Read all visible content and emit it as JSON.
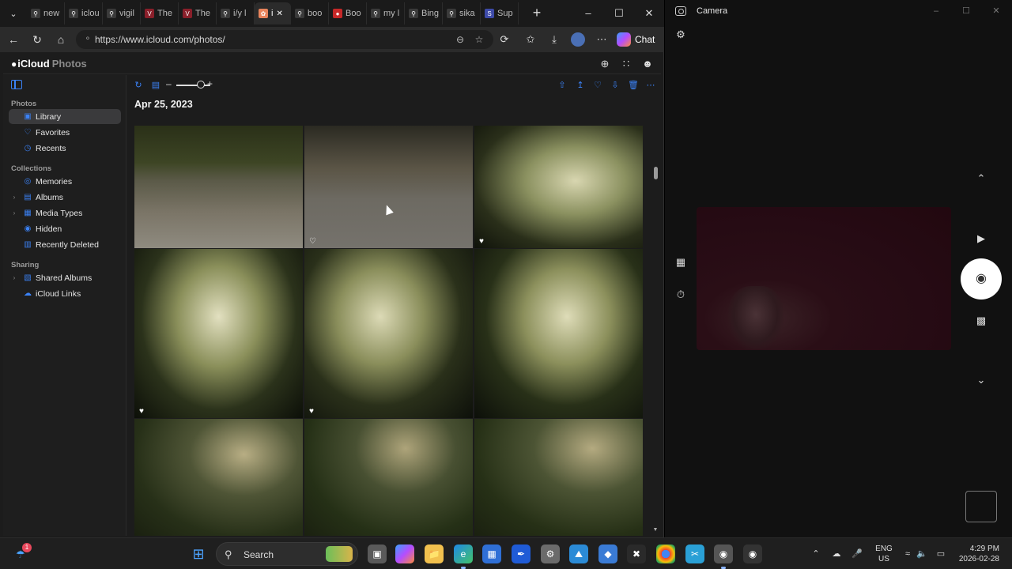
{
  "browser": {
    "tabs": [
      {
        "title": "new",
        "icon": "search-icon",
        "color": "#3a3a3a"
      },
      {
        "title": "iclou",
        "icon": "search-icon",
        "color": "#3a3a3a"
      },
      {
        "title": "vigil",
        "icon": "search-icon",
        "color": "#3a3a3a"
      },
      {
        "title": "The",
        "icon": "vi-icon",
        "color": "#8a1f2a"
      },
      {
        "title": "The",
        "icon": "vi-icon",
        "color": "#8a1f2a"
      },
      {
        "title": "i/y l",
        "icon": "search-icon",
        "color": "#3a3a3a"
      },
      {
        "title": "i",
        "icon": "photos-icon",
        "color": "#e8845c",
        "active": true
      },
      {
        "title": "boo",
        "icon": "search-icon",
        "color": "#3a3a3a"
      },
      {
        "title": "Boo",
        "icon": "record-icon",
        "color": "#c62828"
      },
      {
        "title": "my l",
        "icon": "search-icon",
        "color": "#3a3a3a"
      },
      {
        "title": "Bing",
        "icon": "search-icon",
        "color": "#3a3a3a"
      },
      {
        "title": "sika",
        "icon": "search-icon",
        "color": "#3a3a3a"
      },
      {
        "title": "Sup",
        "icon": "s-icon",
        "color": "#3d4aa8"
      }
    ],
    "url": "https://www.icloud.com/photos/",
    "chat_label": "Chat"
  },
  "icloud": {
    "brand": "iCloud",
    "app_name": "Photos"
  },
  "sidebar": {
    "sections": [
      {
        "title": "Photos",
        "items": [
          {
            "label": "Library",
            "icon": "library-icon",
            "selected": true
          },
          {
            "label": "Favorites",
            "icon": "heart-icon"
          },
          {
            "label": "Recents",
            "icon": "clock-icon"
          }
        ]
      },
      {
        "title": "Collections",
        "items": [
          {
            "label": "Memories",
            "icon": "memories-icon"
          },
          {
            "label": "Albums",
            "icon": "albums-icon",
            "expandable": true
          },
          {
            "label": "Media Types",
            "icon": "media-types-icon",
            "expandable": true
          },
          {
            "label": "Hidden",
            "icon": "eye-icon"
          },
          {
            "label": "Recently Deleted",
            "icon": "trash-icon"
          }
        ]
      },
      {
        "title": "Sharing",
        "items": [
          {
            "label": "Shared Albums",
            "icon": "shared-albums-icon",
            "expandable": true
          },
          {
            "label": "iCloud Links",
            "icon": "link-icon"
          }
        ]
      }
    ]
  },
  "main": {
    "date_heading": "Apr 25, 2023",
    "zoom_level": 0.6,
    "photos": [
      {
        "scene": "fence-street",
        "favorite": false
      },
      {
        "scene": "fence-road",
        "favorite_outline": true
      },
      {
        "scene": "flowering-bush",
        "favorite": true
      },
      {
        "scene": "bush-night",
        "favorite": true
      },
      {
        "scene": "bush-wires",
        "favorite": true
      },
      {
        "scene": "bush-wires-2",
        "favorite": false
      },
      {
        "scene": "branches",
        "favorite": false
      },
      {
        "scene": "branches-sign",
        "favorite": false
      },
      {
        "scene": "branches-sign-2",
        "favorite": false
      }
    ]
  },
  "camera": {
    "title": "Camera"
  },
  "taskbar": {
    "search_label": "Search",
    "notification_count": "1",
    "lang_line1": "ENG",
    "lang_line2": "US",
    "time": "4:29 PM",
    "date": "2026-02-28"
  }
}
